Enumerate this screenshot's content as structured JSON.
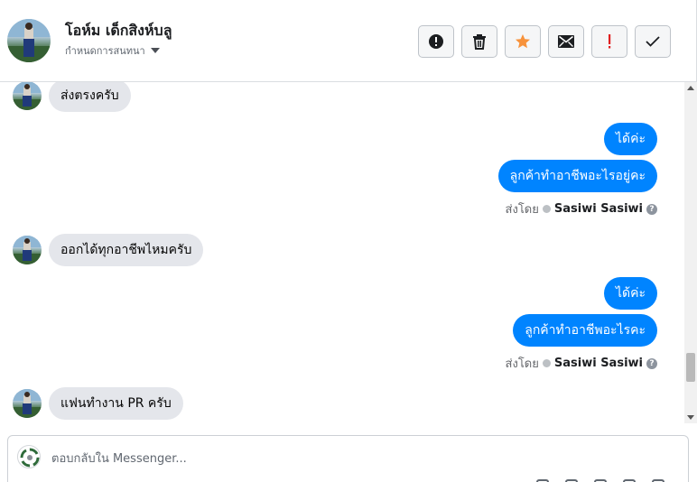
{
  "header": {
    "contact_name": "โอห์ม เด็กสิงห์บลู",
    "assign_label": "กำหนดการสนทนา",
    "actions": [
      {
        "icon": "alert-circle-icon"
      },
      {
        "icon": "trash-icon"
      },
      {
        "icon": "star-icon",
        "color": "#f7923b"
      },
      {
        "icon": "envelope-icon"
      },
      {
        "icon": "exclamation-icon",
        "color": "#e02020"
      },
      {
        "icon": "check-icon"
      }
    ]
  },
  "messages": [
    {
      "direction": "in",
      "text": "ส่งตรงครับ"
    },
    {
      "direction": "out",
      "text": "ได้ค่ะ"
    },
    {
      "direction": "out",
      "text": "ลูกค้าทำอาชีพอะไรอยู่คะ"
    },
    {
      "direction": "in",
      "text": "ออกได้ทุกอาชีพไหมครับ"
    },
    {
      "direction": "out",
      "text": "ได้ค่ะ"
    },
    {
      "direction": "out",
      "text": "ลูกค้าทำอาชีพอะไรคะ"
    },
    {
      "direction": "in",
      "text": "แฟนทำงาน PR ครับ"
    }
  ],
  "sent_by": {
    "label": "ส่งโดย",
    "agent": "Sasiwi Sasiwi",
    "help": "?"
  },
  "composer": {
    "placeholder": "ตอบกลับใน Messenger..."
  },
  "colors": {
    "outgoing_bubble": "#0084ff",
    "incoming_bubble": "#e4e6eb",
    "star": "#f7923b",
    "urgent": "#e02020"
  }
}
